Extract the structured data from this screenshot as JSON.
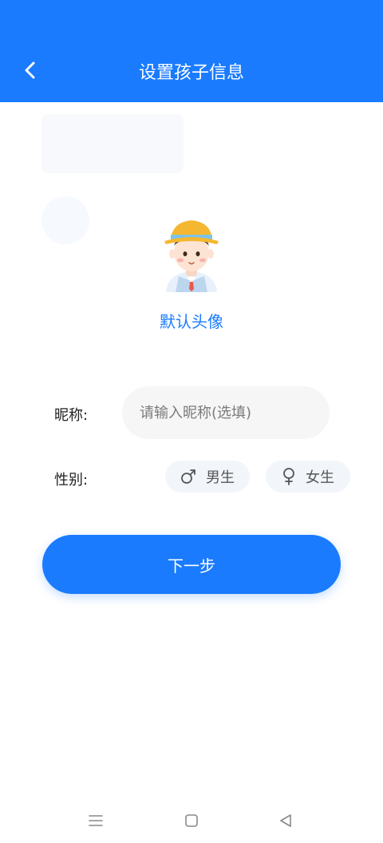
{
  "header": {
    "title": "设置孩子信息",
    "back_icon": "chevron-left-icon",
    "background": "#1a7bff"
  },
  "avatar": {
    "icon": "child-avatar-icon",
    "label": "默认头像"
  },
  "form": {
    "nickname_label": "昵称:",
    "nickname_placeholder": "请输入昵称(选填)",
    "nickname_value": "",
    "gender_label": "性别:",
    "gender_options": [
      {
        "label": "男生",
        "icon": "male-symbol-icon"
      },
      {
        "label": "女生",
        "icon": "female-symbol-icon"
      }
    ]
  },
  "next_button": {
    "label": "下一步",
    "color": "#1a7bff"
  },
  "system_nav": {
    "items": [
      "menu-icon",
      "home-square-icon",
      "back-triangle-icon"
    ]
  }
}
